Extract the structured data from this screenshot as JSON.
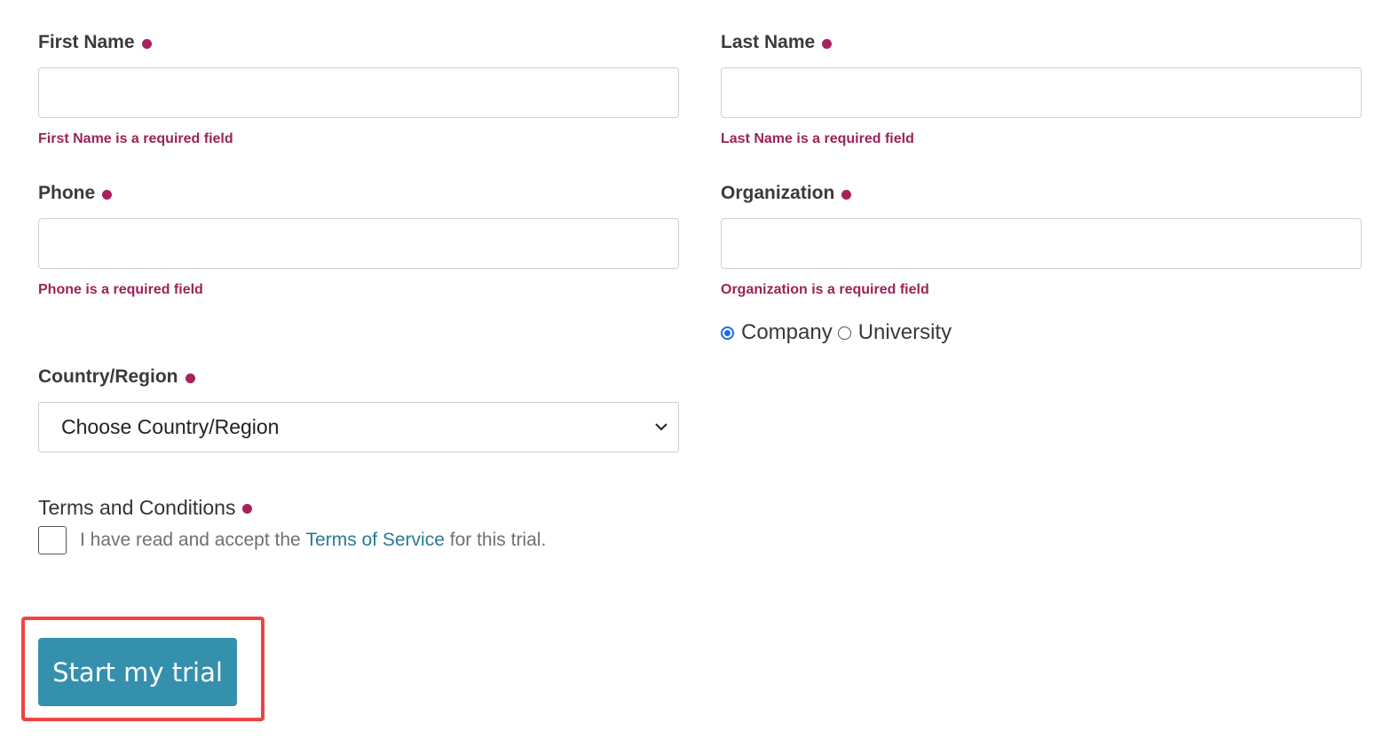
{
  "form": {
    "first_name": {
      "label": "First Name",
      "value": "",
      "error": "First Name is a required field"
    },
    "last_name": {
      "label": "Last Name",
      "value": "",
      "error": "Last Name is a required field"
    },
    "phone": {
      "label": "Phone",
      "value": "",
      "error": "Phone is a required field"
    },
    "organization": {
      "label": "Organization",
      "value": "",
      "error": "Organization is a required field",
      "type_options": [
        {
          "label": "Company",
          "selected": true
        },
        {
          "label": "University",
          "selected": false
        }
      ]
    },
    "country": {
      "label": "Country/Region",
      "selected": "Choose Country/Region"
    },
    "terms": {
      "label": "Terms and Conditions",
      "text_before": "I have read and accept the",
      "link_text": "Terms of Service",
      "text_after": "for this trial.",
      "checked": false
    },
    "submit_label": "Start my trial"
  },
  "colors": {
    "required_dot": "#a8215a",
    "error_text": "#9b2356",
    "link": "#2a7a94",
    "button_bg": "#3490ad",
    "highlight_border": "#ef4444",
    "radio_accent": "#1a6fe0"
  }
}
